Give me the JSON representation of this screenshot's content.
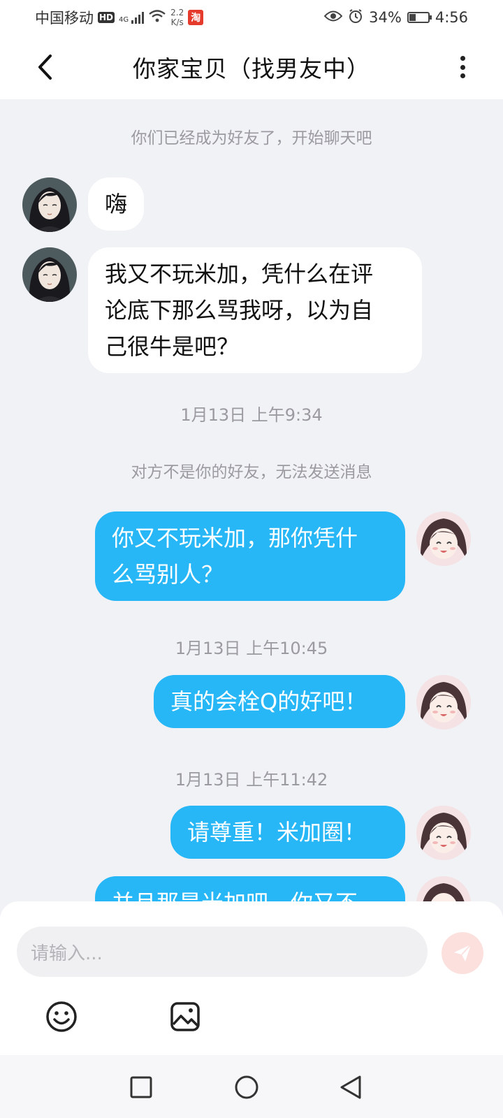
{
  "status_bar": {
    "carrier": "中国移动",
    "hd": "HD",
    "network": "4G",
    "net_speed_value": "2.2",
    "net_speed_unit": "K/s",
    "taobao_glyph": "淘",
    "battery_percent": "34%",
    "battery_level": 0.34,
    "time": "4:56"
  },
  "header": {
    "title": "你家宝贝（找男友中）"
  },
  "chat": {
    "system_friend": "你们已经成为好友了，开始聊天吧",
    "incoming": [
      {
        "text": "嗨"
      },
      {
        "lines": [
          "我又不玩米加，凭什么在评",
          "论底下那么骂我呀，以为自",
          "己很牛是吧？"
        ]
      }
    ],
    "time_1": "1月13日 上午9:34",
    "system_not_friend": "对方不是你的好友，无法发送消息",
    "outgoing_1": {
      "lines": [
        "你又不玩米加，那你凭什",
        "么骂别人？"
      ]
    },
    "time_2": "1月13日 上午10:45",
    "outgoing_2": {
      "text": "真的会栓Q的好吧！"
    },
    "time_3": "1月13日 上午11:42",
    "outgoing_3": {
      "text": "请尊重！米加圈！"
    },
    "outgoing_4_partial": {
      "text": "并且那是米加吧，你又不"
    }
  },
  "input": {
    "placeholder": "请输入..."
  },
  "icons": {
    "back": "chevron-left-icon",
    "more": "more-vertical-icon",
    "send": "send-icon",
    "emoji": "emoji-icon",
    "image": "image-icon",
    "nav_recent": "square-icon",
    "nav_home": "circle-icon",
    "nav_back": "triangle-back-icon"
  },
  "colors": {
    "outgoing_bubble": "#27b6f6",
    "incoming_bubble": "#ffffff",
    "background": "#f1f2f6",
    "send_button": "#fce0de"
  }
}
